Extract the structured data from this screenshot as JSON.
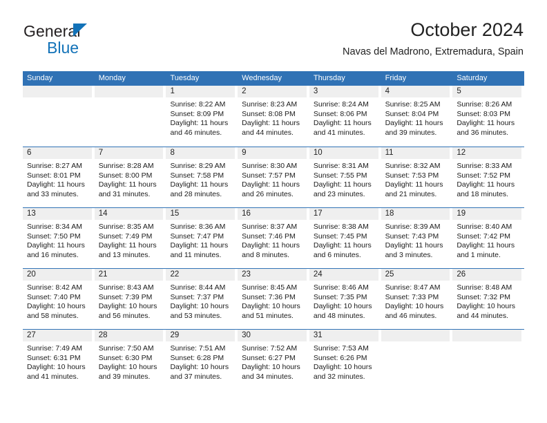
{
  "brand": {
    "line1": "General",
    "line2": "Blue",
    "triangle_color": "#1272b8"
  },
  "header": {
    "title": "October 2024",
    "subtitle": "Navas del Madrono, Extremadura, Spain",
    "accent_color": "#3072b5",
    "daynum_band_color": "#efefef"
  },
  "weekdays": [
    "Sunday",
    "Monday",
    "Tuesday",
    "Wednesday",
    "Thursday",
    "Friday",
    "Saturday"
  ],
  "weeks": [
    {
      "days": [
        {
          "num": "",
          "sunrise": "",
          "sunset": "",
          "daylight1": "",
          "daylight2": ""
        },
        {
          "num": "",
          "sunrise": "",
          "sunset": "",
          "daylight1": "",
          "daylight2": ""
        },
        {
          "num": "1",
          "sunrise": "Sunrise: 8:22 AM",
          "sunset": "Sunset: 8:09 PM",
          "daylight1": "Daylight: 11 hours",
          "daylight2": "and 46 minutes."
        },
        {
          "num": "2",
          "sunrise": "Sunrise: 8:23 AM",
          "sunset": "Sunset: 8:08 PM",
          "daylight1": "Daylight: 11 hours",
          "daylight2": "and 44 minutes."
        },
        {
          "num": "3",
          "sunrise": "Sunrise: 8:24 AM",
          "sunset": "Sunset: 8:06 PM",
          "daylight1": "Daylight: 11 hours",
          "daylight2": "and 41 minutes."
        },
        {
          "num": "4",
          "sunrise": "Sunrise: 8:25 AM",
          "sunset": "Sunset: 8:04 PM",
          "daylight1": "Daylight: 11 hours",
          "daylight2": "and 39 minutes."
        },
        {
          "num": "5",
          "sunrise": "Sunrise: 8:26 AM",
          "sunset": "Sunset: 8:03 PM",
          "daylight1": "Daylight: 11 hours",
          "daylight2": "and 36 minutes."
        }
      ]
    },
    {
      "days": [
        {
          "num": "6",
          "sunrise": "Sunrise: 8:27 AM",
          "sunset": "Sunset: 8:01 PM",
          "daylight1": "Daylight: 11 hours",
          "daylight2": "and 33 minutes."
        },
        {
          "num": "7",
          "sunrise": "Sunrise: 8:28 AM",
          "sunset": "Sunset: 8:00 PM",
          "daylight1": "Daylight: 11 hours",
          "daylight2": "and 31 minutes."
        },
        {
          "num": "8",
          "sunrise": "Sunrise: 8:29 AM",
          "sunset": "Sunset: 7:58 PM",
          "daylight1": "Daylight: 11 hours",
          "daylight2": "and 28 minutes."
        },
        {
          "num": "9",
          "sunrise": "Sunrise: 8:30 AM",
          "sunset": "Sunset: 7:57 PM",
          "daylight1": "Daylight: 11 hours",
          "daylight2": "and 26 minutes."
        },
        {
          "num": "10",
          "sunrise": "Sunrise: 8:31 AM",
          "sunset": "Sunset: 7:55 PM",
          "daylight1": "Daylight: 11 hours",
          "daylight2": "and 23 minutes."
        },
        {
          "num": "11",
          "sunrise": "Sunrise: 8:32 AM",
          "sunset": "Sunset: 7:53 PM",
          "daylight1": "Daylight: 11 hours",
          "daylight2": "and 21 minutes."
        },
        {
          "num": "12",
          "sunrise": "Sunrise: 8:33 AM",
          "sunset": "Sunset: 7:52 PM",
          "daylight1": "Daylight: 11 hours",
          "daylight2": "and 18 minutes."
        }
      ]
    },
    {
      "days": [
        {
          "num": "13",
          "sunrise": "Sunrise: 8:34 AM",
          "sunset": "Sunset: 7:50 PM",
          "daylight1": "Daylight: 11 hours",
          "daylight2": "and 16 minutes."
        },
        {
          "num": "14",
          "sunrise": "Sunrise: 8:35 AM",
          "sunset": "Sunset: 7:49 PM",
          "daylight1": "Daylight: 11 hours",
          "daylight2": "and 13 minutes."
        },
        {
          "num": "15",
          "sunrise": "Sunrise: 8:36 AM",
          "sunset": "Sunset: 7:47 PM",
          "daylight1": "Daylight: 11 hours",
          "daylight2": "and 11 minutes."
        },
        {
          "num": "16",
          "sunrise": "Sunrise: 8:37 AM",
          "sunset": "Sunset: 7:46 PM",
          "daylight1": "Daylight: 11 hours",
          "daylight2": "and 8 minutes."
        },
        {
          "num": "17",
          "sunrise": "Sunrise: 8:38 AM",
          "sunset": "Sunset: 7:45 PM",
          "daylight1": "Daylight: 11 hours",
          "daylight2": "and 6 minutes."
        },
        {
          "num": "18",
          "sunrise": "Sunrise: 8:39 AM",
          "sunset": "Sunset: 7:43 PM",
          "daylight1": "Daylight: 11 hours",
          "daylight2": "and 3 minutes."
        },
        {
          "num": "19",
          "sunrise": "Sunrise: 8:40 AM",
          "sunset": "Sunset: 7:42 PM",
          "daylight1": "Daylight: 11 hours",
          "daylight2": "and 1 minute."
        }
      ]
    },
    {
      "days": [
        {
          "num": "20",
          "sunrise": "Sunrise: 8:42 AM",
          "sunset": "Sunset: 7:40 PM",
          "daylight1": "Daylight: 10 hours",
          "daylight2": "and 58 minutes."
        },
        {
          "num": "21",
          "sunrise": "Sunrise: 8:43 AM",
          "sunset": "Sunset: 7:39 PM",
          "daylight1": "Daylight: 10 hours",
          "daylight2": "and 56 minutes."
        },
        {
          "num": "22",
          "sunrise": "Sunrise: 8:44 AM",
          "sunset": "Sunset: 7:37 PM",
          "daylight1": "Daylight: 10 hours",
          "daylight2": "and 53 minutes."
        },
        {
          "num": "23",
          "sunrise": "Sunrise: 8:45 AM",
          "sunset": "Sunset: 7:36 PM",
          "daylight1": "Daylight: 10 hours",
          "daylight2": "and 51 minutes."
        },
        {
          "num": "24",
          "sunrise": "Sunrise: 8:46 AM",
          "sunset": "Sunset: 7:35 PM",
          "daylight1": "Daylight: 10 hours",
          "daylight2": "and 48 minutes."
        },
        {
          "num": "25",
          "sunrise": "Sunrise: 8:47 AM",
          "sunset": "Sunset: 7:33 PM",
          "daylight1": "Daylight: 10 hours",
          "daylight2": "and 46 minutes."
        },
        {
          "num": "26",
          "sunrise": "Sunrise: 8:48 AM",
          "sunset": "Sunset: 7:32 PM",
          "daylight1": "Daylight: 10 hours",
          "daylight2": "and 44 minutes."
        }
      ]
    },
    {
      "days": [
        {
          "num": "27",
          "sunrise": "Sunrise: 7:49 AM",
          "sunset": "Sunset: 6:31 PM",
          "daylight1": "Daylight: 10 hours",
          "daylight2": "and 41 minutes."
        },
        {
          "num": "28",
          "sunrise": "Sunrise: 7:50 AM",
          "sunset": "Sunset: 6:30 PM",
          "daylight1": "Daylight: 10 hours",
          "daylight2": "and 39 minutes."
        },
        {
          "num": "29",
          "sunrise": "Sunrise: 7:51 AM",
          "sunset": "Sunset: 6:28 PM",
          "daylight1": "Daylight: 10 hours",
          "daylight2": "and 37 minutes."
        },
        {
          "num": "30",
          "sunrise": "Sunrise: 7:52 AM",
          "sunset": "Sunset: 6:27 PM",
          "daylight1": "Daylight: 10 hours",
          "daylight2": "and 34 minutes."
        },
        {
          "num": "31",
          "sunrise": "Sunrise: 7:53 AM",
          "sunset": "Sunset: 6:26 PM",
          "daylight1": "Daylight: 10 hours",
          "daylight2": "and 32 minutes."
        },
        {
          "num": "",
          "sunrise": "",
          "sunset": "",
          "daylight1": "",
          "daylight2": ""
        },
        {
          "num": "",
          "sunrise": "",
          "sunset": "",
          "daylight1": "",
          "daylight2": ""
        }
      ]
    }
  ]
}
